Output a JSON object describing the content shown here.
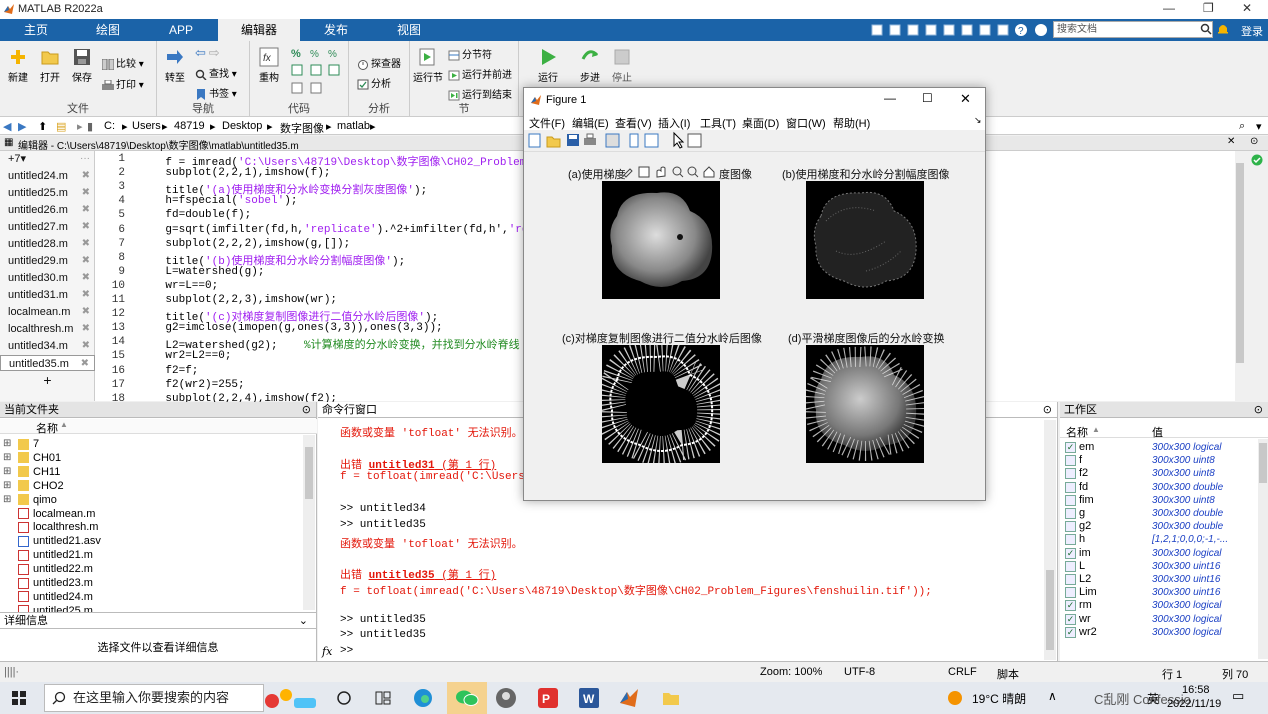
{
  "app": {
    "title": "MATLAB R2022a"
  },
  "window_controls": {
    "minimize": "—",
    "maximize": "❐",
    "close": "✕"
  },
  "ribbon_tabs": [
    "主页",
    "绘图",
    "APP",
    "编辑器",
    "发布",
    "视图"
  ],
  "search": {
    "placeholder": "搜索文档",
    "login": "登录"
  },
  "ribbon": {
    "file": {
      "label": "文件",
      "new": "新建",
      "open": "打开",
      "save": "保存",
      "compare": "比较",
      "print": "打印"
    },
    "nav": {
      "label": "导航",
      "goto": "转至",
      "find": "查找",
      "bookmark": "书签"
    },
    "code": {
      "label": "代码",
      "refactor": "重构"
    },
    "analyze": {
      "label": "分析",
      "profiler": "探查器",
      "analyze": "分析"
    },
    "section": {
      "label": "节",
      "run_section": "运行节",
      "section_break": "分节符",
      "run_advance": "运行并前进",
      "run_to_end": "运行到结束"
    },
    "run": {
      "label": "运行",
      "run": "运行",
      "step": "步进",
      "stop": "停止"
    }
  },
  "address": {
    "segments": [
      "C:",
      "Users",
      "48719",
      "Desktop",
      "数字图像",
      "matlab"
    ]
  },
  "editor": {
    "header": "编辑器 - C:\\Users\\48719\\Desktop\\数字图像\\matlab\\untitled35.m",
    "plus_label": "+7▾",
    "tabs": [
      "untitled24.m",
      "untitled25.m",
      "untitled26.m",
      "untitled27.m",
      "untitled28.m",
      "untitled29.m",
      "untitled30.m",
      "untitled31.m",
      "localmean.m",
      "localthresh.m",
      "untitled34.m",
      "untitled35.m"
    ],
    "lines": [
      {
        "n": "1",
        "pre": "    f = imread(",
        "str": "'C:\\Users\\48719\\Desktop\\数字图像\\CH02_Problem_Fi",
        "post": "",
        "cmt": ""
      },
      {
        "n": "2",
        "pre": "    subplot(2,2,1),imshow(f);",
        "str": "",
        "post": "",
        "cmt": ""
      },
      {
        "n": "3",
        "pre": "    title(",
        "str": "'(a)使用梯度和分水岭变换分割灰度图像'",
        "post": ");",
        "cmt": ""
      },
      {
        "n": "4",
        "pre": "    h=fspecial(",
        "str": "'sobel'",
        "post": ");",
        "cmt": ""
      },
      {
        "n": "5",
        "pre": "    fd=double(f);",
        "str": "",
        "post": "",
        "cmt": ""
      },
      {
        "n": "6",
        "pre": "    g=sqrt(imfilter(fd,h,",
        "str": "'replicate'",
        "post": ").^2+imfilter(fd,h',",
        "cmt": "'replic"
      },
      {
        "n": "7",
        "pre": "    subplot(2,2,2),imshow(g,[]);",
        "str": "",
        "post": "",
        "cmt": ""
      },
      {
        "n": "8",
        "pre": "    title(",
        "str": "'(b)使用梯度和分水岭分割幅度图像'",
        "post": ");",
        "cmt": ""
      },
      {
        "n": "9",
        "pre": "    L=watershed(g);",
        "str": "",
        "post": "",
        "cmt": ""
      },
      {
        "n": "10",
        "pre": "    wr=L==0;",
        "str": "",
        "post": "",
        "cmt": ""
      },
      {
        "n": "11",
        "pre": "    subplot(2,2,3),imshow(wr);",
        "str": "",
        "post": "",
        "cmt": ""
      },
      {
        "n": "12",
        "pre": "    title(",
        "str": "'(c)对梯度复制图像进行二值分水岭后图像'",
        "post": ");",
        "cmt": ""
      },
      {
        "n": "13",
        "pre": "    g2=imclose(imopen(g,ones(3,3)),ones(3,3));",
        "str": "",
        "post": "",
        "cmt": ""
      },
      {
        "n": "14",
        "pre": "    L2=watershed(g2);    ",
        "str": "",
        "post": "",
        "cmt": "%计算梯度的分水岭变换，并找到分水岭脊线"
      },
      {
        "n": "15",
        "pre": "    wr2=L2==0;",
        "str": "",
        "post": "",
        "cmt": ""
      },
      {
        "n": "16",
        "pre": "    f2=f;",
        "str": "",
        "post": "",
        "cmt": ""
      },
      {
        "n": "17",
        "pre": "    f2(wr2)=255;",
        "str": "",
        "post": "",
        "cmt": ""
      },
      {
        "n": "18",
        "pre": "    subplot(2,2,4),imshow(f2);",
        "str": "",
        "post": "",
        "cmt": ""
      }
    ]
  },
  "current_folder": {
    "title": "当前文件夹",
    "col_name": "名称",
    "items": [
      {
        "name": "7",
        "type": "folder"
      },
      {
        "name": "CH01",
        "type": "folder"
      },
      {
        "name": "CH11",
        "type": "folder"
      },
      {
        "name": "CHO2",
        "type": "folder"
      },
      {
        "name": "qimo",
        "type": "folder"
      },
      {
        "name": "localmean.m",
        "type": "m"
      },
      {
        "name": "localthresh.m",
        "type": "m"
      },
      {
        "name": "untitled21.asv",
        "type": "asv"
      },
      {
        "name": "untitled21.m",
        "type": "m"
      },
      {
        "name": "untitled22.m",
        "type": "m"
      },
      {
        "name": "untitled23.m",
        "type": "m"
      },
      {
        "name": "untitled24.m",
        "type": "m"
      },
      {
        "name": "untitled25.m",
        "type": "m"
      }
    ]
  },
  "details": {
    "title": "详细信息",
    "placeholder": "选择文件以查看详细信息"
  },
  "command_window": {
    "title": "命令行窗口",
    "prompt": "fx",
    "lines": [
      {
        "kind": "err",
        "text": "函数或变量 'tofloat' 无法识别。"
      },
      {
        "kind": "blank",
        "text": ""
      },
      {
        "kind": "errhead",
        "pre": "出错 ",
        "link": "untitled31",
        "post": " (第 1 行)"
      },
      {
        "kind": "err",
        "text": "f = tofloat(imread('C:\\Users"
      },
      {
        "kind": "blank",
        "text": ""
      },
      {
        "kind": "norm",
        "text": ">> untitled34"
      },
      {
        "kind": "norm",
        "text": ">> untitled35"
      },
      {
        "kind": "err",
        "text": "函数或变量 'tofloat' 无法识别。"
      },
      {
        "kind": "blank",
        "text": ""
      },
      {
        "kind": "errhead",
        "pre": "出错 ",
        "link": "untitled35",
        "post": " (第 1 行)"
      },
      {
        "kind": "err",
        "text": "f = tofloat(imread('C:\\Users\\48719\\Desktop\\数字图像\\CH02_Problem_Figures\\fenshuilin.tif'));"
      },
      {
        "kind": "blank",
        "text": ""
      },
      {
        "kind": "norm",
        "text": ">> untitled35"
      },
      {
        "kind": "norm",
        "text": ">> untitled35"
      },
      {
        "kind": "norm",
        "text": ">>"
      }
    ]
  },
  "workspace": {
    "title": "工作区",
    "col_name": "名称",
    "col_value": "值",
    "vars": [
      {
        "name": "em",
        "value": "300x300 logical",
        "check": true
      },
      {
        "name": "f",
        "value": "300x300 uint8",
        "check": false
      },
      {
        "name": "f2",
        "value": "300x300 uint8",
        "check": false
      },
      {
        "name": "fd",
        "value": "300x300 double",
        "check": false
      },
      {
        "name": "fim",
        "value": "300x300 uint8",
        "check": false
      },
      {
        "name": "g",
        "value": "300x300 double",
        "check": false
      },
      {
        "name": "g2",
        "value": "300x300 double",
        "check": false
      },
      {
        "name": "h",
        "value": "[1,2,1;0,0,0;-1,-...",
        "check": false
      },
      {
        "name": "im",
        "value": "300x300 logical",
        "check": true
      },
      {
        "name": "L",
        "value": "300x300 uint16",
        "check": false
      },
      {
        "name": "L2",
        "value": "300x300 uint16",
        "check": false
      },
      {
        "name": "Lim",
        "value": "300x300 uint16",
        "check": false
      },
      {
        "name": "rm",
        "value": "300x300 logical",
        "check": true
      },
      {
        "name": "wr",
        "value": "300x300 logical",
        "check": true
      },
      {
        "name": "wr2",
        "value": "300x300 logical",
        "check": true
      }
    ]
  },
  "status": {
    "zoom": "Zoom: 100%",
    "encoding": "UTF-8",
    "eol": "CRLF",
    "type": "脚本",
    "row": "行 1",
    "col": "列 70"
  },
  "figure": {
    "title": "Figure 1",
    "menu": [
      "文件(F)",
      "编辑(E)",
      "查看(V)",
      "插入(I)",
      "工具(T)",
      "桌面(D)",
      "窗口(W)",
      "帮助(H)"
    ],
    "subplot_titles": [
      "(a)使用梯度",
      "度图像",
      "(b)使用梯度和分水岭分割幅度图像",
      "(c)对梯度复制图像进行二值分水岭后图像",
      "(d)平滑梯度图像后的分水岭变换"
    ]
  },
  "taskbar": {
    "search_placeholder": "在这里输入你要搜索的内容",
    "weather": "19°C  晴朗",
    "time": "16:58",
    "date": "2022/11/19",
    "lang": "英",
    "overlay": "C乱刚 Confessio"
  },
  "colors": {
    "ribbon_blue": "#1b63a8",
    "string": "#a020f0",
    "comment": "#228b22",
    "error": "#e3170a",
    "ws_value": "#1a3fc4"
  }
}
